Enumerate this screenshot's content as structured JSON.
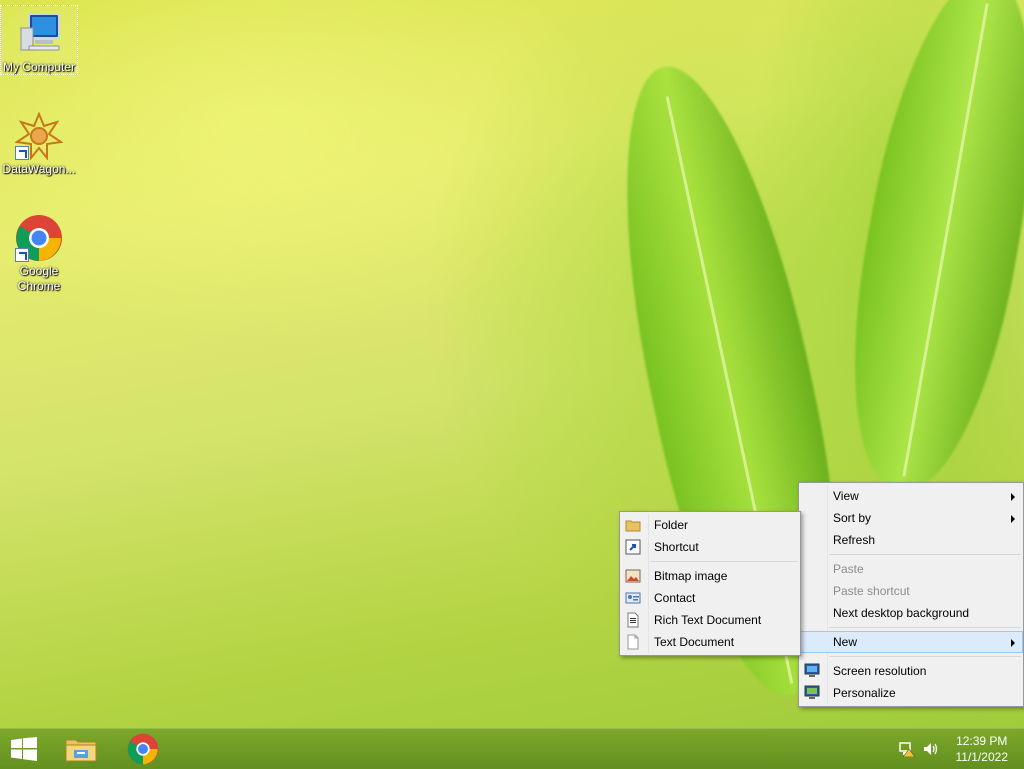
{
  "desktop": {
    "icons": [
      {
        "label": "My Computer",
        "icon": "computer-icon"
      },
      {
        "label": "DataWagon...",
        "icon": "datawagon-icon"
      },
      {
        "label": "Google Chrome",
        "icon": "chrome-icon"
      }
    ]
  },
  "context_menu": {
    "items": [
      {
        "label": "View"
      },
      {
        "label": "Sort by"
      },
      {
        "label": "Refresh"
      },
      {
        "label": "Paste"
      },
      {
        "label": "Paste shortcut"
      },
      {
        "label": "Next desktop background"
      },
      {
        "label": "New"
      },
      {
        "label": "Screen resolution"
      },
      {
        "label": "Personalize"
      }
    ]
  },
  "new_submenu": {
    "items": [
      {
        "label": "Folder",
        "icon": "folder-icon"
      },
      {
        "label": "Shortcut",
        "icon": "shortcut-icon"
      },
      {
        "label": "Bitmap image",
        "icon": "bitmap-icon"
      },
      {
        "label": "Contact",
        "icon": "contact-icon"
      },
      {
        "label": "Rich Text Document",
        "icon": "rich-text-icon"
      },
      {
        "label": "Text Document",
        "icon": "text-document-icon"
      }
    ]
  },
  "taskbar": {
    "buttons": [
      "start-icon",
      "file-explorer-icon",
      "chrome-icon"
    ],
    "clock": {
      "time": "12:39 PM",
      "date": "11/1/2022"
    }
  },
  "colors": {
    "menu_bg": "#f0f0f0",
    "menu_highlight": "#dcebfc",
    "taskbar": "#6f9a2c"
  }
}
